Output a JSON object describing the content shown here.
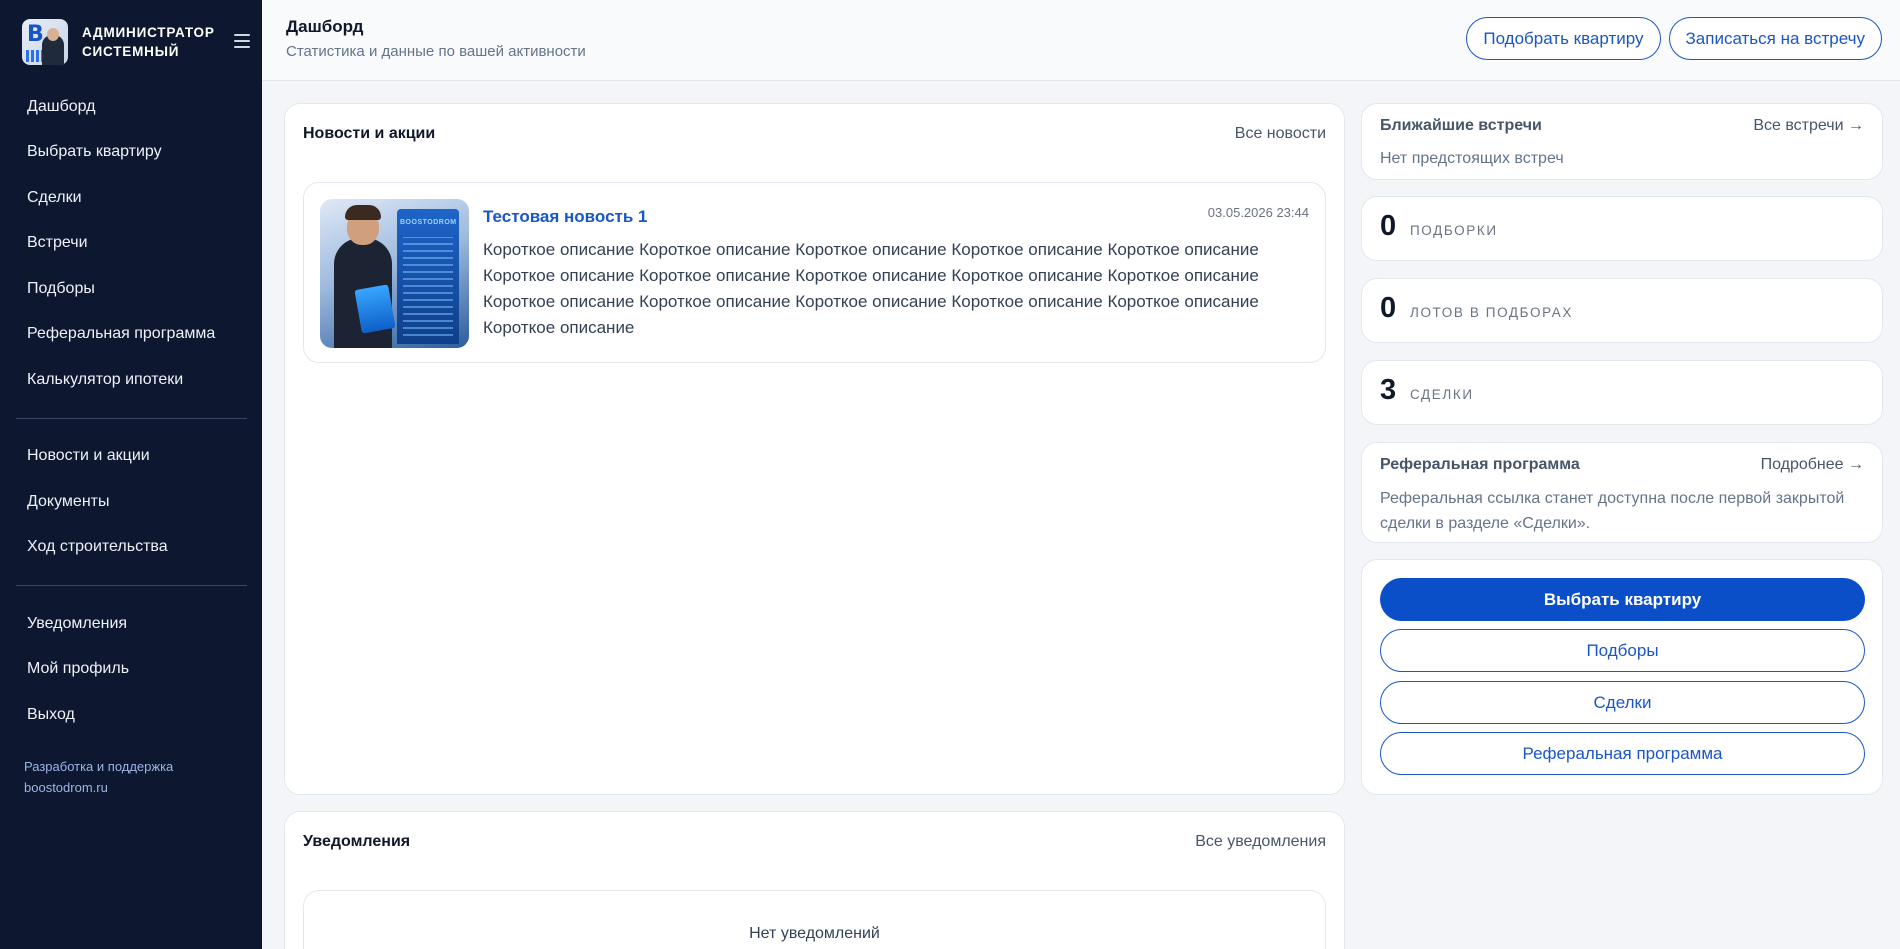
{
  "sidebar": {
    "user_name_line1": "АДМИНИСТРАТОР",
    "user_name_line2": "СИСТЕМНЫЙ",
    "avatar_letter": "B",
    "nav_main": [
      "Дашборд",
      "Выбрать квартиру",
      "Сделки",
      "Встречи",
      "Подборы",
      "Реферальная программа",
      "Калькулятор ипотеки"
    ],
    "nav_info": [
      "Новости и акции",
      "Документы",
      "Ход строительства"
    ],
    "nav_account": [
      "Уведомления",
      "Мой профиль",
      "Выход"
    ],
    "footer_line1": "Разработка и поддержка",
    "footer_line2": "boostodrom.ru"
  },
  "header": {
    "title": "Дашборд",
    "subtitle": "Статистика и данные по вашей активности",
    "btn_pick": "Подобрать квартиру",
    "btn_meeting": "Записаться на встречу"
  },
  "news": {
    "title": "Новости и акции",
    "all_link": "Все новости",
    "items": [
      {
        "title": "Тестовая новость 1",
        "date": "03.05.2026 23:44",
        "description": "Короткое описание Короткое описание Короткое описание Короткое описание Короткое описание Короткое описание Короткое описание Короткое описание Короткое описание Короткое описание Короткое описание Короткое описание Короткое описание Короткое описание Короткое описание Короткое описание",
        "thumb_sign": "BOOSTODROM"
      }
    ]
  },
  "notifications": {
    "title": "Уведомления",
    "all_link": "Все уведомления",
    "empty": "Нет уведомлений"
  },
  "meetings": {
    "title": "Ближайшие встречи",
    "all_link": "Все встречи →",
    "empty": "Нет предстоящих встреч"
  },
  "stats": [
    {
      "value": "0",
      "label": "ПОДБОРКИ"
    },
    {
      "value": "0",
      "label": "ЛОТОВ В ПОДБОРАХ"
    },
    {
      "value": "3",
      "label": "СДЕЛКИ"
    }
  ],
  "referral": {
    "title": "Реферальная программа",
    "link": "Подробнее →",
    "text": "Реферальная ссылка станет доступна после первой закрытой сделки в разделе «Сделки»."
  },
  "quick_actions": {
    "primary": "Выбрать квартиру",
    "selections": "Подборы",
    "deals": "Сделки",
    "referral": "Реферальная программа"
  },
  "colors": {
    "sidebar_bg": "#0d1830",
    "accent": "#0b4fc8",
    "link": "#1a56c7"
  }
}
